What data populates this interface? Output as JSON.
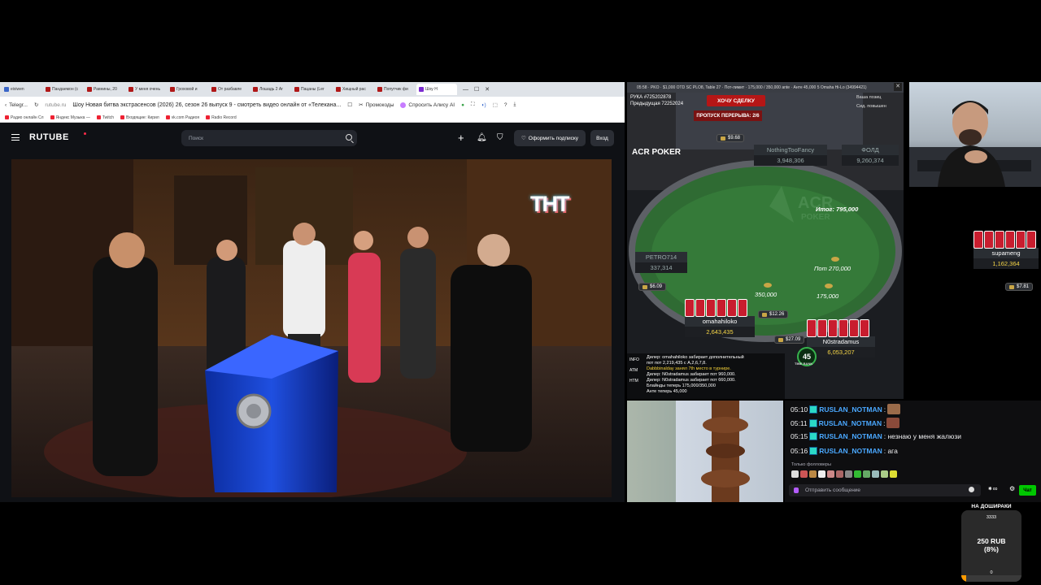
{
  "browser": {
    "tabs": [
      {
        "label": "eixiwen",
        "active": false,
        "icon": "blue"
      },
      {
        "label": "Пандаемон (с",
        "active": false,
        "icon": "red"
      },
      {
        "label": "Равнины, 20",
        "active": false,
        "icon": "red"
      },
      {
        "label": "У меня очень",
        "active": false,
        "icon": "red"
      },
      {
        "label": "Гроховой и",
        "active": false,
        "icon": "red"
      },
      {
        "label": "От разбавле",
        "active": false,
        "icon": "red"
      },
      {
        "label": "Лошадь 2 Ar",
        "active": false,
        "icon": "red"
      },
      {
        "label": "Пацаны (Ler",
        "active": false,
        "icon": "red"
      },
      {
        "label": "Хищный рас",
        "active": false,
        "icon": "red"
      },
      {
        "label": "Попутчик фи",
        "active": false,
        "icon": "red"
      },
      {
        "label": "Шоу Н",
        "active": true,
        "icon": "purple"
      }
    ],
    "address": {
      "back_label": "Telegr...",
      "domain": "rutube.ru",
      "page_title": "Шоу Новая битва экстрасенсов (2026) 26, сезон 26 выпуск 9 - смотреть видео онлайн от «Телекана...",
      "promo_label": "Промокоды",
      "alice_label": "Спросить Алису AI"
    },
    "bookmarks": [
      "Радио онлайн Сл",
      "Яндекс Музыка —",
      "Twitch",
      "Входящие: Кирил",
      "vk.com Радиоя",
      "Radio Record"
    ]
  },
  "rutube": {
    "logo": "RUTUBE",
    "search_placeholder": "Поиск",
    "subscribe_label": "Оформить подписку",
    "login_label": "Вход",
    "channel_logo": "ТНТ"
  },
  "poker": {
    "title_bar": "05:58 · PKO · $1,000 OTD SC PLO8, Table 27 · Пот-лимит · 175,000 / 350,000 ante · Анте 45,000 5 Omaha Hi-Lo (34994421)",
    "hand_info": [
      "РУКА #725202878",
      "Предыдущая 72252024"
    ],
    "wish_button": "ХОЧУ СДЕЛКУ",
    "skip_break": "ПРОПУСК ПЕРЕРЫВА: 2/6",
    "options": [
      "Ваша позиц",
      "Сид. повышен"
    ],
    "table_logo": "ACR POKER",
    "total_pot": "Итог: 795,000",
    "pot": "Пот 270,000",
    "players": [
      {
        "name": "NothingTooFancy",
        "stack": "3,948,306",
        "money": "$9.68",
        "folded": true
      },
      {
        "name": "ФОЛД",
        "stack": "9,260,374",
        "money": "",
        "folded": true
      },
      {
        "name": "PETRO714",
        "stack": "337,314",
        "money": "$6.09",
        "folded": true
      },
      {
        "name": "supameng",
        "stack": "1,162,364",
        "money": "$7.81",
        "folded": false
      },
      {
        "name": "omahahiloko",
        "stack": "2,643,435",
        "money": "$12.26",
        "folded": false
      },
      {
        "name": "N0stradamus",
        "stack": "6,053,207",
        "money": "$27.09",
        "folded": false
      }
    ],
    "bets": {
      "omahahiloko": "350,000",
      "n0stradamus": "175,000"
    },
    "timebank": {
      "seconds": "45",
      "label": "TIME BANK"
    },
    "dealer_tabs": [
      "INFO",
      "ATM",
      "HTM"
    ],
    "dealer_lines": [
      {
        "text": "Дилер: omahahiloko забирает дополнительный",
        "highlight": false
      },
      {
        "text": "пот пот 2,219,435 с A,2,6,7,8.",
        "highlight": false
      },
      {
        "text": "Dabbbinalday занял 7th место в турнире.",
        "highlight": true
      },
      {
        "text": "Дилер: N0stradamus забирает пот 960,000.",
        "highlight": false
      },
      {
        "text": "Дилер: N0stradamus забирает пот 660,000.",
        "highlight": false
      },
      {
        "text": "Блайнды теперь 175,000/350,000",
        "highlight": false
      },
      {
        "text": "Анте теперь 45,000",
        "highlight": false
      }
    ]
  },
  "chat": {
    "messages": [
      {
        "time": "05:10",
        "user": "RUSLAN_NOTMAN",
        "text": ":",
        "emote": true
      },
      {
        "time": "05:11",
        "user": "RUSLAN_NOTMAN",
        "text": ":",
        "emote": true
      },
      {
        "time": "05:15",
        "user": "RUSLAN_NOTMAN",
        "text": ": незнаю у меня жалюзи",
        "emote": false
      },
      {
        "time": "05:16",
        "user": "RUSLAN_NOTMAN",
        "text": ": ага",
        "emote": false
      }
    ],
    "followers_only": "Только фолловеры",
    "input_placeholder": "Отправить сообщение",
    "send_label": "Чат"
  },
  "goal": {
    "title": "НА ДОШИРАКИ",
    "top": "3333",
    "amount_line1": "250 RUB",
    "amount_line2": "(8%)",
    "bottom": "0",
    "percent": 8
  },
  "colors": {
    "rutube_bg": "#0f1115",
    "poker_felt": "#2f6b33",
    "card_back": "#c81d2e",
    "chat_user": "#4aa8ff",
    "goal_fill": "#ff9b00"
  }
}
